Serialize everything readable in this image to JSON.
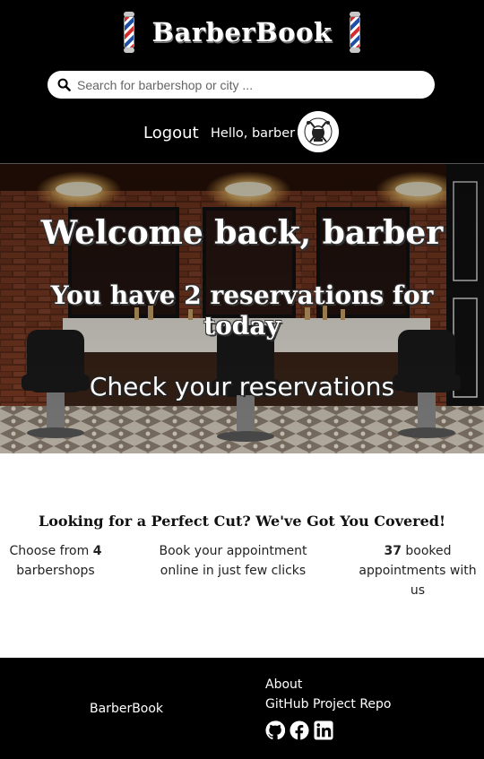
{
  "header": {
    "brand": "BarberBook",
    "search_placeholder": "Search for barbershop or city ...",
    "logout_label": "Logout",
    "greeting": "Hello, barber"
  },
  "hero": {
    "welcome": "Welcome back, barber",
    "reservations": "You have 2 reservations for today",
    "check_link": "Check your reservations"
  },
  "features": {
    "title": "Looking for a Perfect Cut? We've Got You Covered!",
    "item1_prefix": "Choose from ",
    "item1_count": "4",
    "item1_suffix": " barbershops",
    "item2": "Book your appointment online in just few clicks",
    "item3_count": "37",
    "item3_suffix": " booked appointments with us"
  },
  "footer": {
    "brand": "BarberBook",
    "about": "About",
    "repo": "GitHub Project Repo"
  },
  "icons": [
    "barber-pole-icon",
    "search-icon",
    "avatar",
    "github-icon",
    "facebook-icon",
    "linkedin-icon"
  ]
}
